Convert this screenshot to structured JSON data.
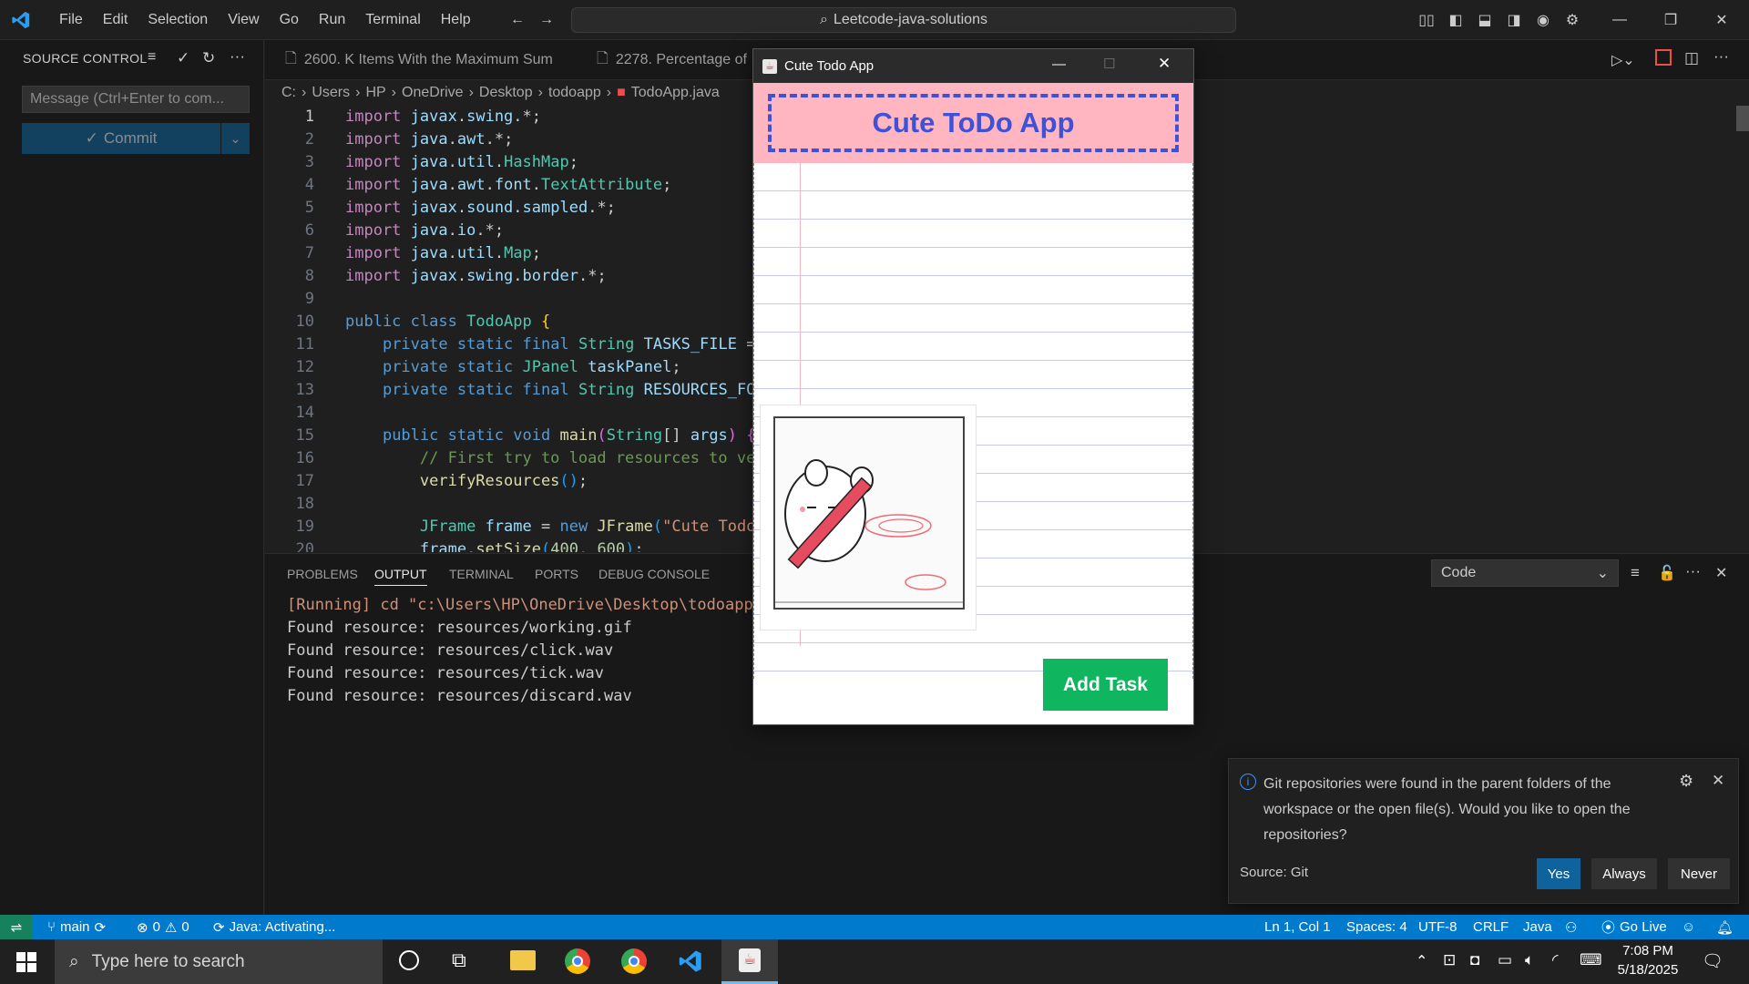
{
  "titlebar": {
    "menu": [
      "File",
      "Edit",
      "Selection",
      "View",
      "Go",
      "Run",
      "Terminal",
      "Help"
    ],
    "search_text": "Leetcode-java-solutions"
  },
  "sidebar": {
    "title": "SOURCE CONTROL",
    "commit_placeholder": "Message (Ctrl+Enter to com...",
    "commit_label": "Commit"
  },
  "tabs": [
    {
      "label": "2600. K Items With the Maximum Sum"
    },
    {
      "label": "2278. Percentage of"
    }
  ],
  "breadcrumb": [
    "C:",
    "Users",
    "HP",
    "OneDrive",
    "Desktop",
    "todoapp",
    "TodoApp.java"
  ],
  "code_lines": [
    {
      "n": "1",
      "html": "<span class='kw2'>import</span> <span class='vr'>javax</span>.<span class='vr'>swing</span>.*;"
    },
    {
      "n": "2",
      "html": "<span class='kw2'>import</span> <span class='vr'>java</span>.<span class='vr'>awt</span>.*;"
    },
    {
      "n": "3",
      "html": "<span class='kw2'>import</span> <span class='vr'>java</span>.<span class='vr'>util</span>.<span class='ty'>HashMap</span>;"
    },
    {
      "n": "4",
      "html": "<span class='kw2'>import</span> <span class='vr'>java</span>.<span class='vr'>awt</span>.<span class='vr'>font</span>.<span class='ty'>TextAttribute</span>;"
    },
    {
      "n": "5",
      "html": "<span class='kw2'>import</span> <span class='vr'>javax</span>.<span class='vr'>sound</span>.<span class='vr'>sampled</span>.*;"
    },
    {
      "n": "6",
      "html": "<span class='kw2'>import</span> <span class='vr'>java</span>.<span class='vr'>io</span>.*;"
    },
    {
      "n": "7",
      "html": "<span class='kw2'>import</span> <span class='vr'>java</span>.<span class='vr'>util</span>.<span class='ty'>Map</span>;"
    },
    {
      "n": "8",
      "html": "<span class='kw2'>import</span> <span class='vr'>javax</span>.<span class='vr'>swing</span>.<span class='vr'>border</span>.*;"
    },
    {
      "n": "9",
      "html": ""
    },
    {
      "n": "10",
      "html": "<span class='kw'>public</span> <span class='kw'>class</span> <span class='ty'>TodoApp</span> <span style='color:#ffd700'>{</span>"
    },
    {
      "n": "11",
      "html": "    <span class='kw'>private</span> <span class='kw'>static</span> <span class='kw'>final</span> <span class='ty'>String</span> <span class='vr'>TASKS_FILE</span> ="
    },
    {
      "n": "12",
      "html": "    <span class='kw'>private</span> <span class='kw'>static</span> <span class='ty'>JPanel</span> <span class='vr'>taskPanel</span>;"
    },
    {
      "n": "13",
      "html": "    <span class='kw'>private</span> <span class='kw'>static</span> <span class='kw'>final</span> <span class='ty'>String</span> <span class='vr'>RESOURCES_FO</span>"
    },
    {
      "n": "14",
      "html": ""
    },
    {
      "n": "15",
      "html": "    <span class='kw'>public</span> <span class='kw'>static</span> <span class='kw'>void</span> <span class='fn'>main</span><span style='color:#da70d6'>(</span><span class='ty'>String</span>[] <span class='vr'>args</span><span style='color:#da70d6'>)</span> <span style='color:#da70d6'>{</span>"
    },
    {
      "n": "16",
      "html": "        <span class='cm'>// First try to load resources to ve</span>"
    },
    {
      "n": "17",
      "html": "        <span class='fn'>verifyResources</span><span style='color:#179fff'>()</span>;"
    },
    {
      "n": "18",
      "html": ""
    },
    {
      "n": "19",
      "html": "        <span class='ty'>JFrame</span> <span class='vr'>frame</span> = <span class='kw'>new</span> <span class='fn'>JFrame</span><span style='color:#179fff'>(</span><span class='str'>\"Cute Todo</span>"
    },
    {
      "n": "20",
      "html": "        <span class='vr'>frame</span>.<span class='fn'>setSize</span><span style='color:#179fff'>(</span><span style='color:#b5cea8'>400</span>, <span style='color:#b5cea8'>600</span><span style='color:#179fff'>)</span>;"
    }
  ],
  "panel": {
    "tabs": [
      "PROBLEMS",
      "OUTPUT",
      "TERMINAL",
      "PORTS",
      "DEBUG CONSOLE"
    ],
    "active_tab": "OUTPUT",
    "output_lines": [
      "[Running] cd \"c:\\Users\\HP\\OneDrive\\Desktop\\todoapp",
      "Found resource: resources/working.gif",
      "Found resource: resources/click.wav",
      "Found resource: resources/tick.wav",
      "Found resource: resources/discard.wav"
    ],
    "channel_select": "Code"
  },
  "java_window": {
    "title": "Cute Todo App",
    "header": "Cute ToDo App",
    "task_input_value": "",
    "add_button": "Add Task"
  },
  "notification": {
    "message": "Git repositories were found in the parent folders of the workspace or the open file(s). Would you like to open the repositories?",
    "source": "Source: Git",
    "buttons": [
      "Yes",
      "Always",
      "Never"
    ]
  },
  "statusbar": {
    "branch": "main",
    "errors": "0",
    "warnings": "0",
    "java_status": "Java: Activating...",
    "position": "Ln 1, Col 1",
    "spaces": "Spaces: 4",
    "encoding": "UTF-8",
    "eol": "CRLF",
    "language": "Java",
    "golive": "Go Live"
  },
  "taskbar": {
    "search_placeholder": "Type here to search",
    "time": "7:08 PM",
    "date": "5/18/2025"
  },
  "colors": {
    "accent": "#007acc",
    "todo_header_bg": "#ffb6c1",
    "todo_header_text": "#3f51d6",
    "add_button": "#0fb55f"
  }
}
